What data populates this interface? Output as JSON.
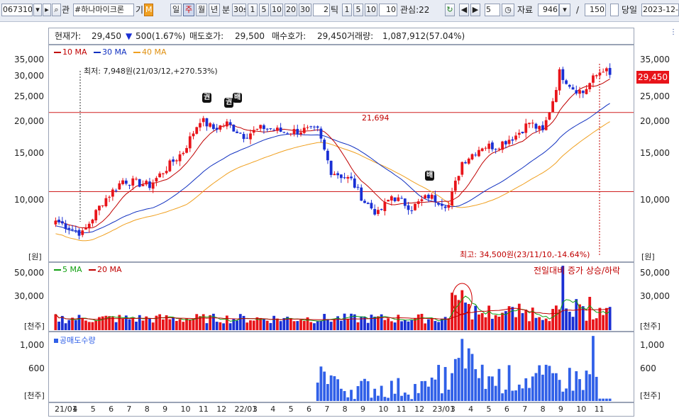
{
  "toolbar": {
    "code": "067310",
    "stock_tag": "관",
    "stock_name": "#하나마이크론",
    "group": "기",
    "m_badge": "M",
    "periods": [
      "일",
      "주",
      "월",
      "년"
    ],
    "minute_label": "분",
    "minute_value": "30s",
    "minutes": [
      "1",
      "5",
      "10",
      "20",
      "30"
    ],
    "tick_value": "2",
    "tick_label": "틱",
    "ticks": [
      "1",
      "5",
      "10"
    ],
    "tick_input": "10",
    "interest": "관심:22",
    "step_value": "5",
    "data_label": "자료",
    "data_count": "946",
    "slash": "/",
    "max_count": "150",
    "today_label": "당일",
    "date_value": "2023-12-"
  },
  "info": {
    "cur_label": "현재가:",
    "cur_value": "29,450",
    "change": "500(1.67%)",
    "ask_label": "매도호가:",
    "ask_value": "29,500",
    "bid_label": "매수호가:",
    "bid_value": "29,450",
    "vol_label": "거래량:",
    "vol_value": "1,087,912(57.04%)"
  },
  "colors": {
    "up": "#e8141a",
    "down": "#1a2fd4",
    "ma10": "#c00000",
    "ma30": "#1030c0",
    "ma40": "#f0a020",
    "vma5": "#10a010",
    "vma20": "#c00000",
    "short": "#3060e8",
    "hline": "#d02020"
  },
  "chart_data": [
    {
      "type": "candlestick",
      "title": "",
      "legend": [
        "10 MA",
        "30 MA",
        "40 MA"
      ],
      "y_ticks": [
        "35,000",
        "30,000",
        "25,000",
        "20,000",
        "15,000",
        "10,000"
      ],
      "y_scale": "log",
      "ylim": [
        6500,
        37000
      ],
      "unit": "[원]",
      "current_price": "29,450",
      "hline_label": "21,694",
      "hlines": [
        21694,
        11400
      ],
      "annotation_low": "최저: 7,948원(21/03/12,+270.53%)",
      "annotation_high": "최고: 34,500원(23/11/10,-14.64%)",
      "markers": [
        "권",
        "권",
        "배",
        "배"
      ],
      "anchors": [
        {
          "i": 0,
          "p": 9000
        },
        {
          "i": 8,
          "p": 8100
        },
        {
          "i": 14,
          "p": 10500
        },
        {
          "i": 20,
          "p": 12500
        },
        {
          "i": 28,
          "p": 12000
        },
        {
          "i": 34,
          "p": 14200
        },
        {
          "i": 38,
          "p": 15800
        },
        {
          "i": 43,
          "p": 20500
        },
        {
          "i": 47,
          "p": 19000
        },
        {
          "i": 51,
          "p": 19800
        },
        {
          "i": 56,
          "p": 18000
        },
        {
          "i": 62,
          "p": 19200
        },
        {
          "i": 68,
          "p": 18500
        },
        {
          "i": 74,
          "p": 18800
        },
        {
          "i": 78,
          "p": 18700
        },
        {
          "i": 82,
          "p": 13500
        },
        {
          "i": 88,
          "p": 12500
        },
        {
          "i": 92,
          "p": 10500
        },
        {
          "i": 96,
          "p": 9500
        },
        {
          "i": 100,
          "p": 11000
        },
        {
          "i": 106,
          "p": 10000
        },
        {
          "i": 111,
          "p": 11000
        },
        {
          "i": 117,
          "p": 10200
        },
        {
          "i": 121,
          "p": 14500
        },
        {
          "i": 127,
          "p": 16500
        },
        {
          "i": 131,
          "p": 16500
        },
        {
          "i": 137,
          "p": 18000
        },
        {
          "i": 141,
          "p": 20000
        },
        {
          "i": 145,
          "p": 18500
        },
        {
          "i": 148,
          "p": 24000
        },
        {
          "i": 150,
          "p": 30000
        },
        {
          "i": 154,
          "p": 26500
        },
        {
          "i": 157,
          "p": 25500
        },
        {
          "i": 160,
          "p": 28500
        },
        {
          "i": 163,
          "p": 31000
        },
        {
          "i": 165,
          "p": 29450
        }
      ]
    },
    {
      "type": "bar",
      "title": "",
      "legend": [
        "5 MA",
        "20 MA"
      ],
      "y_ticks": [
        "50,000",
        "30,000"
      ],
      "ylim": [
        0,
        60000
      ],
      "unit": "[천주]",
      "note": "전일대비 증가 상승/하락"
    },
    {
      "type": "bar",
      "title": "",
      "legend": [
        "공매도수량"
      ],
      "y_ticks": [
        "1,000",
        "600"
      ],
      "ylim": [
        0,
        1150
      ],
      "unit": "[천주]"
    }
  ],
  "x_axis": {
    "labels": [
      "21/01",
      "4",
      "5",
      "6",
      "7",
      "8",
      "9",
      "10",
      "11",
      "12",
      "22/01",
      "3",
      "4",
      "5",
      "6",
      "7",
      "8",
      "9",
      "10",
      "11",
      "12",
      "23/01",
      "3",
      "4",
      "5",
      "6",
      "7",
      "8",
      "9",
      "10",
      "11"
    ]
  }
}
